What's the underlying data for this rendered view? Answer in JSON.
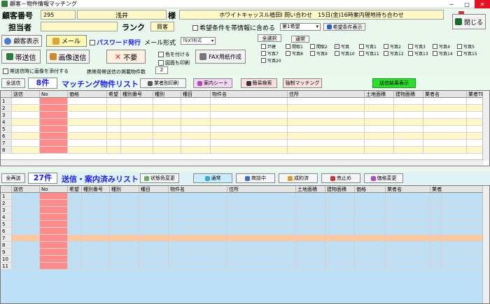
{
  "window": {
    "title": "顧客－物件情報マッチング"
  },
  "header": {
    "customer_no_label": "顧客番号",
    "customer_no": "295",
    "customer_name": "浅井",
    "honorific": "様",
    "inquiry_text": "ホワイトキャッスル植田Ⅰ 問い合わせ　15日(金)16時案内現地待ち合わせ",
    "staff_label": "担当者",
    "staff_value": "",
    "rank_label": "ランク",
    "rank_value": "買客",
    "include_condition_label": "希望条件を帯情報に含める",
    "wish_select": "第1希望",
    "wish_display_button": "希望条件表示",
    "close_button": "閉じる"
  },
  "toolbar": {
    "customer_display": "顧客表示",
    "mail": "メール",
    "password_issue": "パスワード発行",
    "mail_format_label": "メール形式",
    "mail_format_value": "TEXT形式",
    "obi_send": "帯送信",
    "image_send": "画像送信",
    "unneeded": "不要",
    "color_add": "色を付ける",
    "map_print": "図面も印刷",
    "fax_create": "FAX用紙作成",
    "attach_image_label": "帯送信時に画像を添付する",
    "mobile_count_label": "携帯用帯送信の掲載物件数",
    "mobile_count_value": "2",
    "select_all": "全選択",
    "normal": "通常"
  },
  "categories": [
    {
      "label": "戸建",
      "checked": false
    },
    {
      "label": "間取1",
      "checked": false
    },
    {
      "label": "間取2",
      "checked": false
    },
    {
      "label": "写真",
      "checked": true
    },
    {
      "label": "写真1",
      "checked": false
    },
    {
      "label": "写真2",
      "checked": false
    },
    {
      "label": "写真3",
      "checked": false
    },
    {
      "label": "写真4",
      "checked": false
    },
    {
      "label": "写真5",
      "checked": false
    },
    {
      "label": "写真7",
      "checked": false
    },
    {
      "label": "写真8",
      "checked": false
    },
    {
      "label": "写真9",
      "checked": false
    },
    {
      "label": "写真10",
      "checked": false
    },
    {
      "label": "写真11",
      "checked": false
    },
    {
      "label": "写真12",
      "checked": false
    },
    {
      "label": "写真13",
      "checked": false
    },
    {
      "label": "写真14",
      "checked": false
    },
    {
      "label": "写真15",
      "checked": false
    },
    {
      "label": "写真20",
      "checked": false
    }
  ],
  "matching": {
    "send_all": "全送信",
    "count": "8件",
    "title": "マッチング物件リスト",
    "buttons": [
      "業者別印刷",
      "案内シート",
      "簡易検索",
      "強制マッチング",
      "送信結果表示"
    ],
    "columns": [
      "送信",
      "No",
      "価格",
      "希望",
      "種別番号",
      "種別",
      "種目",
      "物件名",
      "住所",
      "土地面積",
      "建物面積",
      "業者名",
      "業者TEL"
    ],
    "row_numbers": [
      "1",
      "2",
      "3",
      "4",
      "5",
      "6",
      "7",
      "8"
    ]
  },
  "sent": {
    "resend_all": "全再送",
    "count": "27件",
    "title": "送信・案内済みリスト",
    "state_change": "状態色変更",
    "status_buttons": [
      "通常",
      "商談中",
      "成約済",
      "売止め",
      "価格変更"
    ],
    "columns": [
      "送信",
      "No",
      "希望",
      "種別番号",
      "種別",
      "種目",
      "物件名",
      "住所",
      "土地面積",
      "建物面積",
      "価格",
      "業者名",
      "業者TEL"
    ],
    "row_numbers": [
      "1",
      "2",
      "3",
      "4",
      "5",
      "6",
      "7",
      "8",
      "9",
      "10",
      "11"
    ]
  },
  "colors": {
    "accent_blue": "#1b1bff",
    "no_column_red": "#ff8a8a",
    "cream_row": "#fff8c6",
    "blue_row": "#bde0f7",
    "peach_row": "#f9c9a3",
    "green_button": "#2ee02e"
  }
}
